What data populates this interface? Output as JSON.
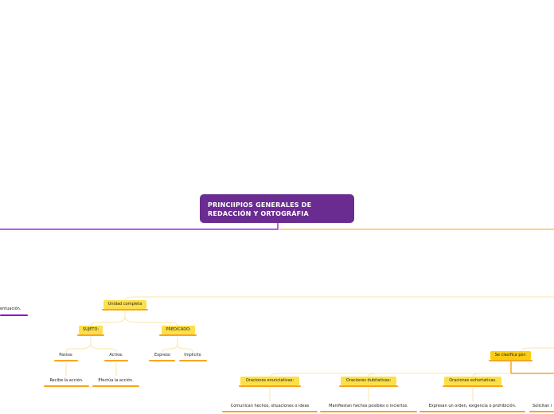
{
  "root": {
    "title_line1": "PRINCIIPIOS GENERALES DE",
    "title_line2": "REDACCIÓN Y ORTOGRÁFIA"
  },
  "left_branch": {
    "partial_label": "entuación."
  },
  "unidad": {
    "label": "Unidad completa",
    "sujeto": {
      "label": "SUJETO:",
      "pasiva": "Pasiva:",
      "activa": "Activa:",
      "pasiva_desc": "Recibe la acción.",
      "activa_desc": "Efectúa la acción."
    },
    "predicado": {
      "label": "PREDICADO:",
      "expreso": "Expreso",
      "implicito": "Implicito"
    }
  },
  "clasifica": {
    "label": "Se clasifica por:",
    "types": [
      {
        "label": "Oraciones enunciativas:",
        "desc": "Comunican hechos, situaciones o ideas"
      },
      {
        "label": "Oraciones dubitativas:",
        "desc": "Manifiestan hechos posibles o inciertos."
      },
      {
        "label": "Oraciones exhortativas.",
        "desc": "Expresan un orden, exigencia o prohibición."
      }
    ],
    "partial_desc": "Solicitan i"
  },
  "colors": {
    "root": "#6a2c91",
    "topic": "#fde047",
    "connector": "#f7a520",
    "accent": "#8b00d6"
  }
}
